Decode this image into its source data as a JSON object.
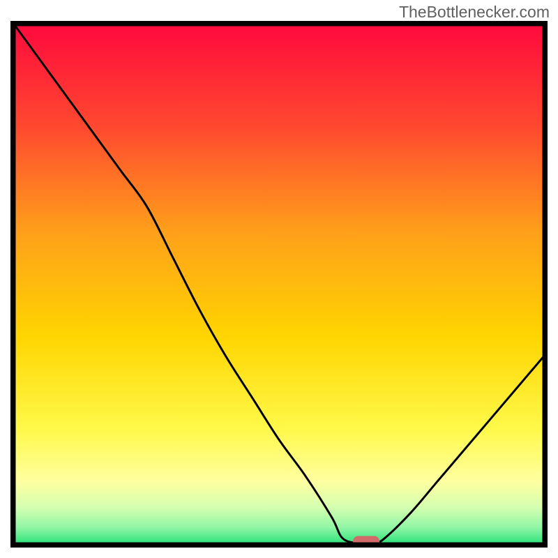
{
  "watermark": "TheBottlenecker.com",
  "chart_data": {
    "type": "line",
    "title": "",
    "xlabel": "",
    "ylabel": "",
    "xlim": [
      0,
      100
    ],
    "ylim": [
      0,
      100
    ],
    "x": [
      0,
      5,
      10,
      15,
      20,
      25,
      30,
      35,
      40,
      45,
      50,
      55,
      60,
      62,
      65,
      68,
      70,
      75,
      80,
      85,
      90,
      95,
      100
    ],
    "y": [
      100,
      93,
      86,
      79,
      72,
      65,
      55,
      45,
      36,
      28,
      20,
      13,
      5,
      1,
      0,
      0,
      1,
      6,
      12,
      18,
      24,
      30,
      36
    ],
    "optimal_marker": {
      "x": 66.5,
      "y": 0
    },
    "gradient_stops": [
      {
        "offset": 0.0,
        "color": "#ff0a3d"
      },
      {
        "offset": 0.2,
        "color": "#ff4a2f"
      },
      {
        "offset": 0.4,
        "color": "#ffa01a"
      },
      {
        "offset": 0.6,
        "color": "#ffd500"
      },
      {
        "offset": 0.78,
        "color": "#fff94a"
      },
      {
        "offset": 0.88,
        "color": "#ffffa0"
      },
      {
        "offset": 0.93,
        "color": "#d5ffb0"
      },
      {
        "offset": 0.97,
        "color": "#8ff5a5"
      },
      {
        "offset": 1.0,
        "color": "#2ee37a"
      }
    ],
    "marker_color": "#d36a6a",
    "frame_color": "#000000"
  }
}
